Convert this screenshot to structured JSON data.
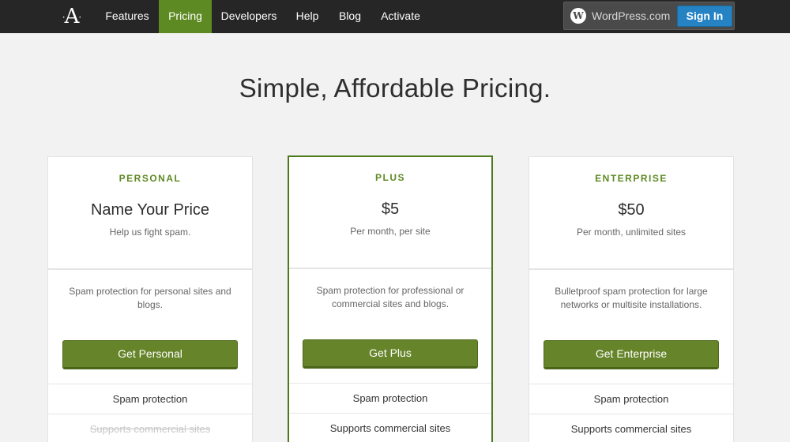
{
  "nav": {
    "logo": "A",
    "items": [
      {
        "label": "Features",
        "active": false
      },
      {
        "label": "Pricing",
        "active": true
      },
      {
        "label": "Developers",
        "active": false
      },
      {
        "label": "Help",
        "active": false
      },
      {
        "label": "Blog",
        "active": false
      },
      {
        "label": "Activate",
        "active": false
      }
    ],
    "wordpress_label": "WordPress.com",
    "signin_label": "Sign In"
  },
  "headline": "Simple, Affordable Pricing.",
  "plans": [
    {
      "tier": "PERSONAL",
      "price": "Name Your Price",
      "price_note": "Help us fight spam.",
      "description": "Spam protection for personal sites and blogs.",
      "cta": "Get Personal",
      "features": [
        {
          "label": "Spam protection",
          "included": true
        },
        {
          "label": "Supports commercial sites",
          "included": false
        }
      ]
    },
    {
      "tier": "PLUS",
      "price": "$5",
      "price_note": "Per month, per site",
      "description": "Spam protection for professional or commercial sites and blogs.",
      "cta": "Get Plus",
      "features": [
        {
          "label": "Spam protection",
          "included": true
        },
        {
          "label": "Supports commercial sites",
          "included": true
        }
      ]
    },
    {
      "tier": "ENTERPRISE",
      "price": "$50",
      "price_note": "Per month, unlimited sites",
      "description": "Bulletproof spam protection for large networks or multisite installations.",
      "cta": "Get Enterprise",
      "features": [
        {
          "label": "Spam protection",
          "included": true
        },
        {
          "label": "Supports commercial sites",
          "included": true
        }
      ]
    }
  ],
  "colors": {
    "accent": "#5e8a23",
    "button": "#66842a",
    "signin": "#2583c4",
    "topbar": "#262626",
    "background": "#f3f2f3"
  }
}
